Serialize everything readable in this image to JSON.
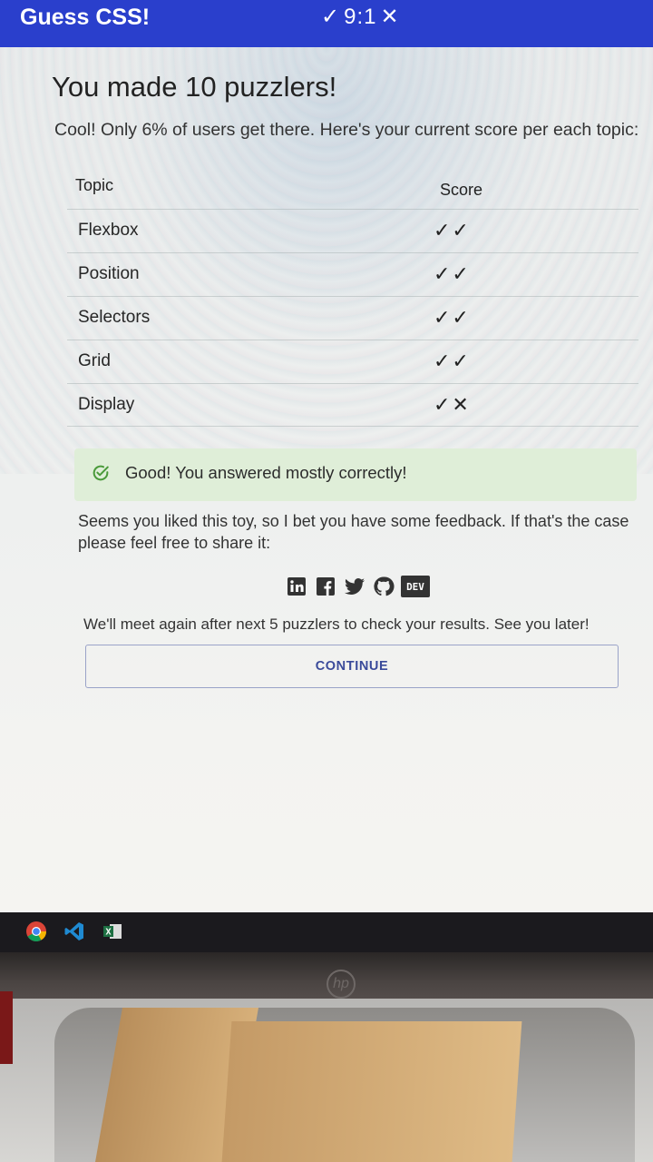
{
  "app": {
    "title": "Guess CSS!",
    "score_ok": "✓",
    "score_text": "9:1",
    "score_bad": "✕",
    "accent": "#2a3fcc"
  },
  "main": {
    "heading": "You made 10 puzzlers!",
    "subtitle": "Cool! Only 6% of users get there. Here's your current score per each topic:",
    "table": {
      "headers": {
        "topic": "Topic",
        "score": "Score"
      },
      "rows": [
        {
          "topic": "Flexbox",
          "score": "✓✓"
        },
        {
          "topic": "Position",
          "score": "✓✓"
        },
        {
          "topic": "Selectors",
          "score": "✓✓"
        },
        {
          "topic": "Grid",
          "score": "✓✓"
        },
        {
          "topic": "Display",
          "score": "✓✕"
        }
      ]
    },
    "alert": {
      "text": "Good! You answered mostly correctly!",
      "color": "#dfeed8",
      "icon": "check-circle-icon"
    },
    "feedback": "Seems you liked this toy, so I bet you have some feedback. If that's the case please feel free to share it:",
    "socials": [
      {
        "name": "linkedin-icon"
      },
      {
        "name": "facebook-icon"
      },
      {
        "name": "twitter-icon"
      },
      {
        "name": "github-icon"
      },
      {
        "name": "dev-icon",
        "label": "DEV"
      }
    ],
    "later": "We'll meet again after next 5 puzzlers to check your results. See you later!",
    "continue_label": "CONTINUE"
  },
  "taskbar": {
    "icons": [
      "chrome-icon",
      "vscode-icon",
      "excel-icon"
    ]
  }
}
